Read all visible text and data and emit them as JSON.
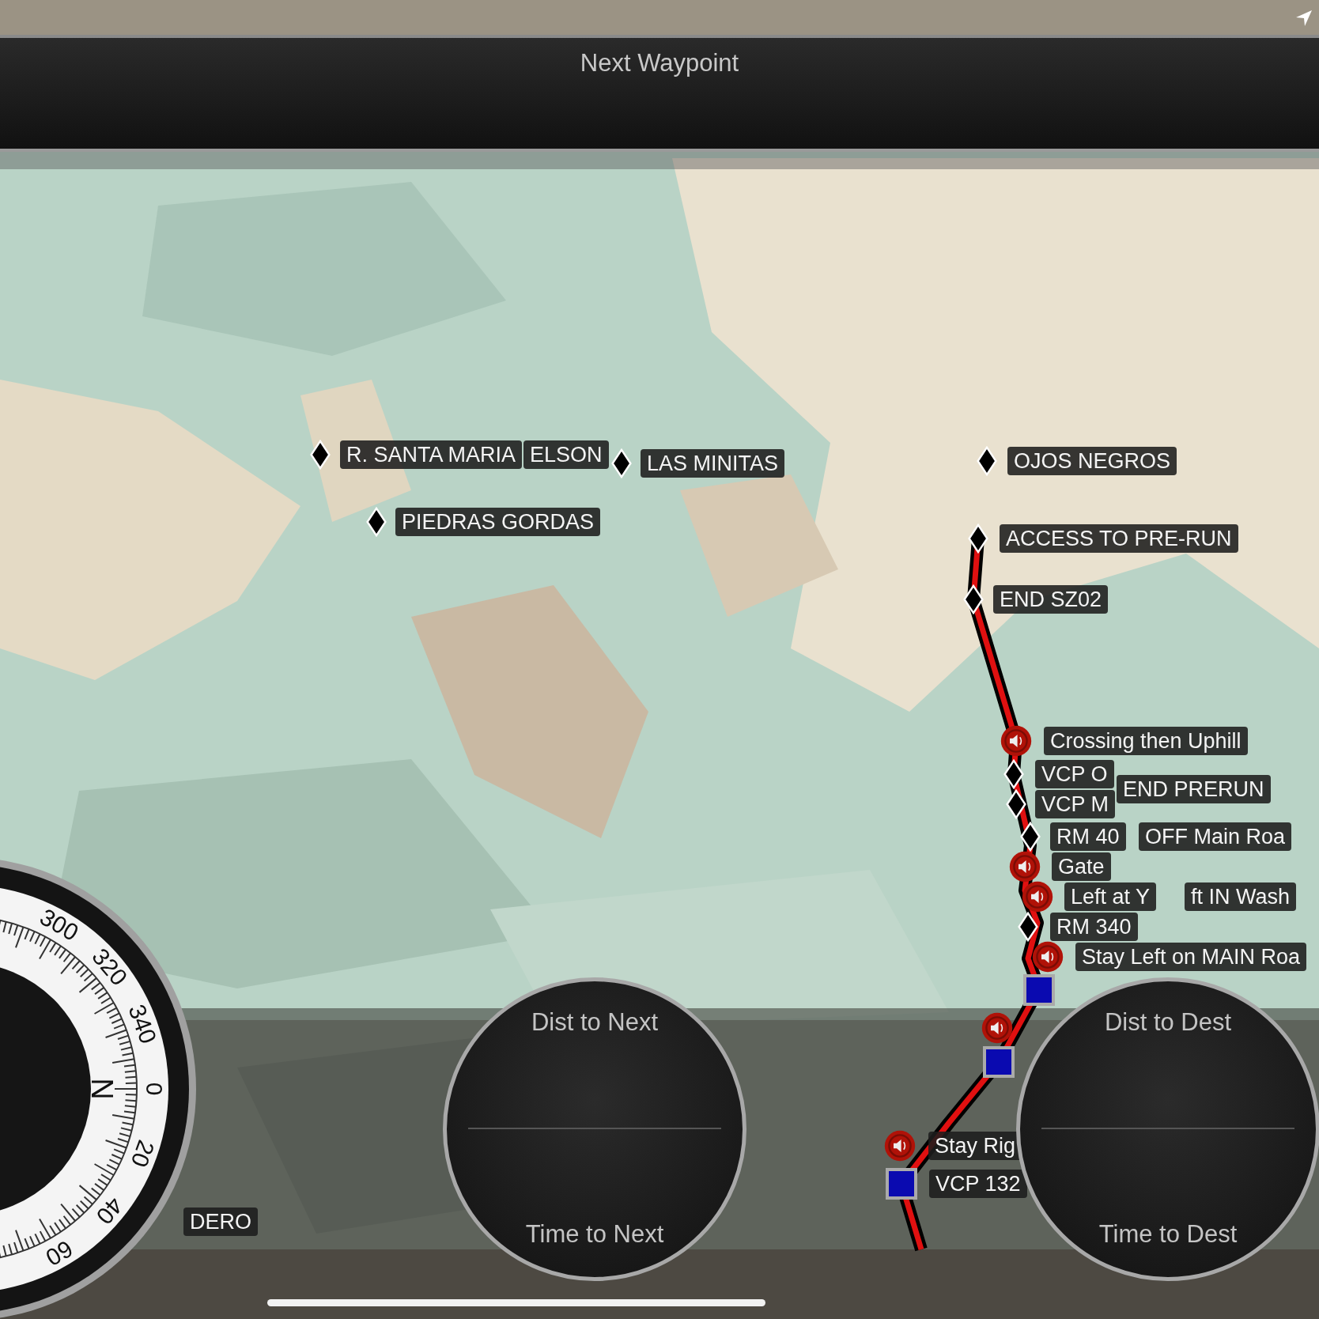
{
  "header": {
    "title": "Next Waypoint"
  },
  "map": {
    "kind": "picture",
    "waypoints": [
      {
        "label": "R. SANTA MARIA",
        "kind": "diamond"
      },
      {
        "label": "ELSON",
        "kind": "none"
      },
      {
        "label": "LAS MINITAS",
        "kind": "diamond"
      },
      {
        "label": "OJOS NEGROS",
        "kind": "diamond"
      },
      {
        "label": "PIEDRAS GORDAS",
        "kind": "diamond"
      },
      {
        "label": "ACCESS TO PRE-RUN",
        "kind": "diamond"
      },
      {
        "label": "END SZ02",
        "kind": "diamond"
      },
      {
        "label": "Crossing then Uphill",
        "kind": "speaker"
      },
      {
        "label": "VCP O",
        "kind": "diamond"
      },
      {
        "label": "VCP M",
        "kind": "diamond"
      },
      {
        "label": "END PRERUN",
        "kind": "none"
      },
      {
        "label": "RM 40",
        "kind": "diamond"
      },
      {
        "label": "OFF Main Roa",
        "kind": "none"
      },
      {
        "label": "Gate",
        "kind": "speaker"
      },
      {
        "label": "Left at Y",
        "kind": "speaker"
      },
      {
        "label": "ft IN Wash",
        "kind": "none"
      },
      {
        "label": "RM 340",
        "kind": "diamond"
      },
      {
        "label": "Stay Left on MAIN Roa",
        "kind": "speaker"
      },
      {
        "kind": "square"
      },
      {
        "kind": "speaker"
      },
      {
        "kind": "square"
      },
      {
        "label": "Stay Rig",
        "kind": "speaker"
      },
      {
        "label": "VCP 132",
        "kind": "square"
      },
      {
        "label": "DERO",
        "kind": "none"
      }
    ]
  },
  "compass": {
    "cardinal": "N",
    "degrees": [
      "300",
      "320",
      "340",
      "0",
      "20",
      "40",
      "60"
    ]
  },
  "gauges": [
    {
      "top": "Dist to Next",
      "bottom": "Time to Next"
    },
    {
      "top": "Dist to Dest",
      "bottom": "Time to Dest"
    }
  ]
}
